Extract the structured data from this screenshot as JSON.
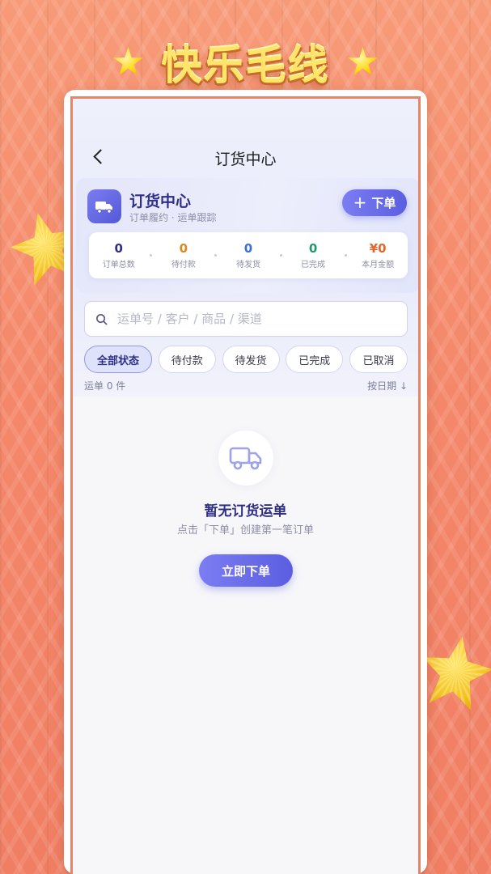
{
  "banner": {
    "title": "快乐毛线"
  },
  "nav": {
    "title": "订货中心"
  },
  "header": {
    "title": "订货中心",
    "subtitle": "订单履约 · 运单跟踪",
    "order_button": "下单"
  },
  "stats": [
    {
      "value": "0",
      "label": "订单总数",
      "color": "#2f2f87"
    },
    {
      "value": "0",
      "label": "待付款",
      "color": "#d98a1e"
    },
    {
      "value": "0",
      "label": "待发货",
      "color": "#3b6fd9"
    },
    {
      "value": "0",
      "label": "已完成",
      "color": "#1e9a6a"
    },
    {
      "value": "¥0",
      "label": "本月金额",
      "color": "#e0662a"
    }
  ],
  "search": {
    "placeholder": "运单号 / 客户 / 商品 / 渠道"
  },
  "filters": [
    "全部状态",
    "待付款",
    "待发货",
    "已完成",
    "已取消"
  ],
  "active_filter": "全部状态",
  "list": {
    "count_text": "运单 0 件",
    "sort_text": "按日期 ↓"
  },
  "empty": {
    "title": "暂无订货运单",
    "subtitle": "点击「下单」创建第一笔订单",
    "cta": "立即下单"
  },
  "icons": {
    "back": "chevron-left-icon",
    "truck": "truck-icon",
    "search": "search-icon",
    "plus": "plus-icon"
  }
}
